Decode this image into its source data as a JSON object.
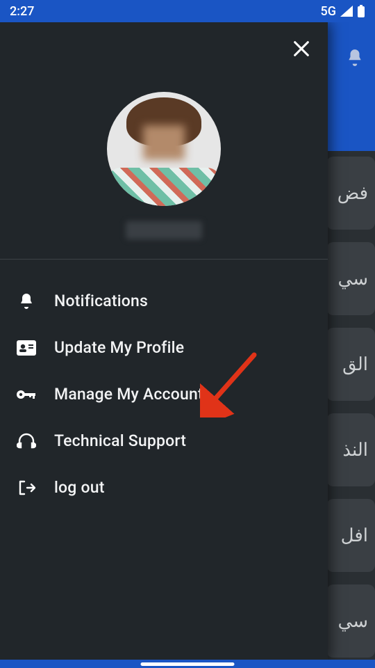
{
  "statusbar": {
    "time": "2:27",
    "network": "5G"
  },
  "background": {
    "cards": [
      "فض",
      "سي",
      "الق",
      "النذ",
      "افل",
      "سي"
    ]
  },
  "drawer": {
    "menu": {
      "notifications": "Notifications",
      "update_profile": "Update My Profile",
      "manage_account": "Manage My Account",
      "tech_support": "Technical Support",
      "logout": "log out"
    }
  },
  "annotation": {
    "arrow_target": "manage_account"
  }
}
